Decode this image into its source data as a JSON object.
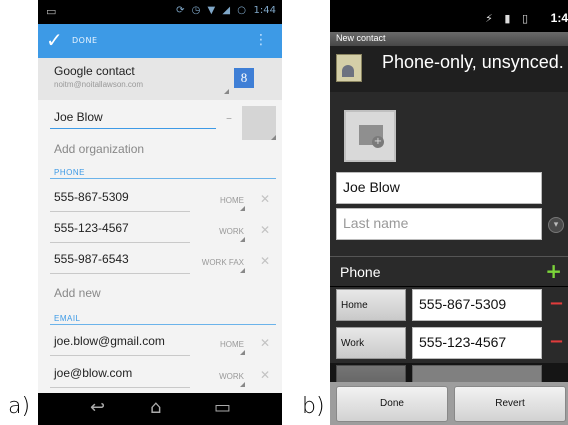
{
  "labels": {
    "a": "a)",
    "b": "b)"
  },
  "phone_a": {
    "status": {
      "time": "1:44"
    },
    "action_bar": {
      "done": "DONE"
    },
    "account": {
      "title": "Google contact",
      "email": "noitm@noitallawson.com"
    },
    "name": "Joe Blow",
    "organization_hint": "Add organization",
    "phone_section": "PHONE",
    "phones": [
      {
        "number": "555-867-5309",
        "type": "HOME"
      },
      {
        "number": "555-123-4567",
        "type": "WORK"
      },
      {
        "number": "555-987-6543",
        "type": "WORK FAX"
      }
    ],
    "add_new_hint": "Add new",
    "email_section": "EMAIL",
    "emails": [
      {
        "address": "joe.blow@gmail.com",
        "type": "HOME"
      },
      {
        "address": "joe@blow.com",
        "type": "WORK"
      }
    ]
  },
  "phone_b": {
    "status": {
      "time": "1:4"
    },
    "title": "New contact",
    "account_text": "Phone-only, unsynced.",
    "first_name": "Joe Blow",
    "last_name_placeholder": "Last name",
    "phone_section": "Phone",
    "phones": [
      {
        "type": "Home",
        "number": "555-867-5309"
      },
      {
        "type": "Work",
        "number": "555-123-4567"
      }
    ],
    "buttons": {
      "done": "Done",
      "revert": "Revert"
    }
  }
}
